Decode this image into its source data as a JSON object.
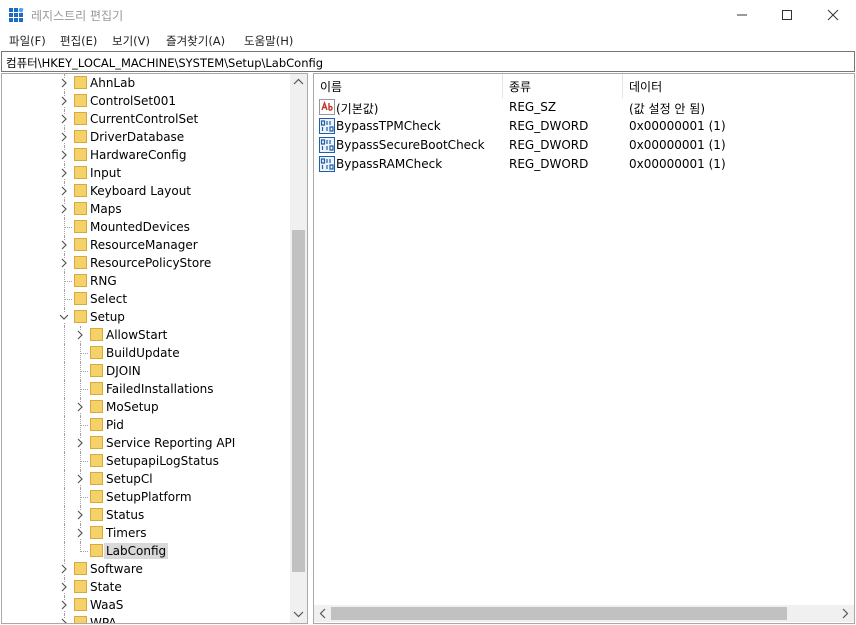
{
  "window": {
    "title": "레지스트리 편집기"
  },
  "menu": [
    "파일(F)",
    "편집(E)",
    "보기(V)",
    "즐겨찾기(A)",
    "도움말(H)"
  ],
  "address": "컴퓨터\\HKEY_LOCAL_MACHINE\\SYSTEM\\Setup\\LabConfig",
  "tree": {
    "items": [
      {
        "label": "AhnLab",
        "level": 1,
        "expandable": true
      },
      {
        "label": "ControlSet001",
        "level": 1,
        "expandable": true
      },
      {
        "label": "CurrentControlSet",
        "level": 1,
        "expandable": true
      },
      {
        "label": "DriverDatabase",
        "level": 1,
        "expandable": true
      },
      {
        "label": "HardwareConfig",
        "level": 1,
        "expandable": true
      },
      {
        "label": "Input",
        "level": 1,
        "expandable": true
      },
      {
        "label": "Keyboard Layout",
        "level": 1,
        "expandable": true
      },
      {
        "label": "Maps",
        "level": 1,
        "expandable": true
      },
      {
        "label": "MountedDevices",
        "level": 1,
        "expandable": false
      },
      {
        "label": "ResourceManager",
        "level": 1,
        "expandable": true
      },
      {
        "label": "ResourcePolicyStore",
        "level": 1,
        "expandable": true
      },
      {
        "label": "RNG",
        "level": 1,
        "expandable": false
      },
      {
        "label": "Select",
        "level": 1,
        "expandable": false
      },
      {
        "label": "Setup",
        "level": 1,
        "expandable": true,
        "expanded": true
      },
      {
        "label": "AllowStart",
        "level": 2,
        "expandable": true
      },
      {
        "label": "BuildUpdate",
        "level": 2,
        "expandable": false
      },
      {
        "label": "DJOIN",
        "level": 2,
        "expandable": false
      },
      {
        "label": "FailedInstallations",
        "level": 2,
        "expandable": false
      },
      {
        "label": "MoSetup",
        "level": 2,
        "expandable": true
      },
      {
        "label": "Pid",
        "level": 2,
        "expandable": false
      },
      {
        "label": "Service Reporting API",
        "level": 2,
        "expandable": true
      },
      {
        "label": "SetupapiLogStatus",
        "level": 2,
        "expandable": false
      },
      {
        "label": "SetupCl",
        "level": 2,
        "expandable": true
      },
      {
        "label": "SetupPlatform",
        "level": 2,
        "expandable": false
      },
      {
        "label": "Status",
        "level": 2,
        "expandable": true
      },
      {
        "label": "Timers",
        "level": 2,
        "expandable": true
      },
      {
        "label": "LabConfig",
        "level": 2,
        "expandable": false,
        "selected": true
      },
      {
        "label": "Software",
        "level": 1,
        "expandable": true
      },
      {
        "label": "State",
        "level": 1,
        "expandable": true
      },
      {
        "label": "WaaS",
        "level": 1,
        "expandable": true
      },
      {
        "label": "WPA",
        "level": 1,
        "expandable": true
      }
    ]
  },
  "list": {
    "columns": [
      "이름",
      "종류",
      "데이터"
    ],
    "rows": [
      {
        "icon": "string-value-icon",
        "name": "(기본값)",
        "type": "REG_SZ",
        "data": "(값 설정 안 됨)"
      },
      {
        "icon": "dword-value-icon",
        "name": "BypassTPMCheck",
        "type": "REG_DWORD",
        "data": "0x00000001 (1)"
      },
      {
        "icon": "dword-value-icon",
        "name": "BypassSecureBootCheck",
        "type": "REG_DWORD",
        "data": "0x00000001 (1)"
      },
      {
        "icon": "dword-value-icon",
        "name": "BypassRAMCheck",
        "type": "REG_DWORD",
        "data": "0x00000001 (1)"
      }
    ]
  },
  "colors": {
    "folder": "#f5d16a",
    "folder_edge": "#d9a93a",
    "selection": "#d9d9d9",
    "scroll_thumb": "#c1c1c1",
    "string_icon": "#c0392b",
    "dword_icon": "#1f5fa8"
  }
}
